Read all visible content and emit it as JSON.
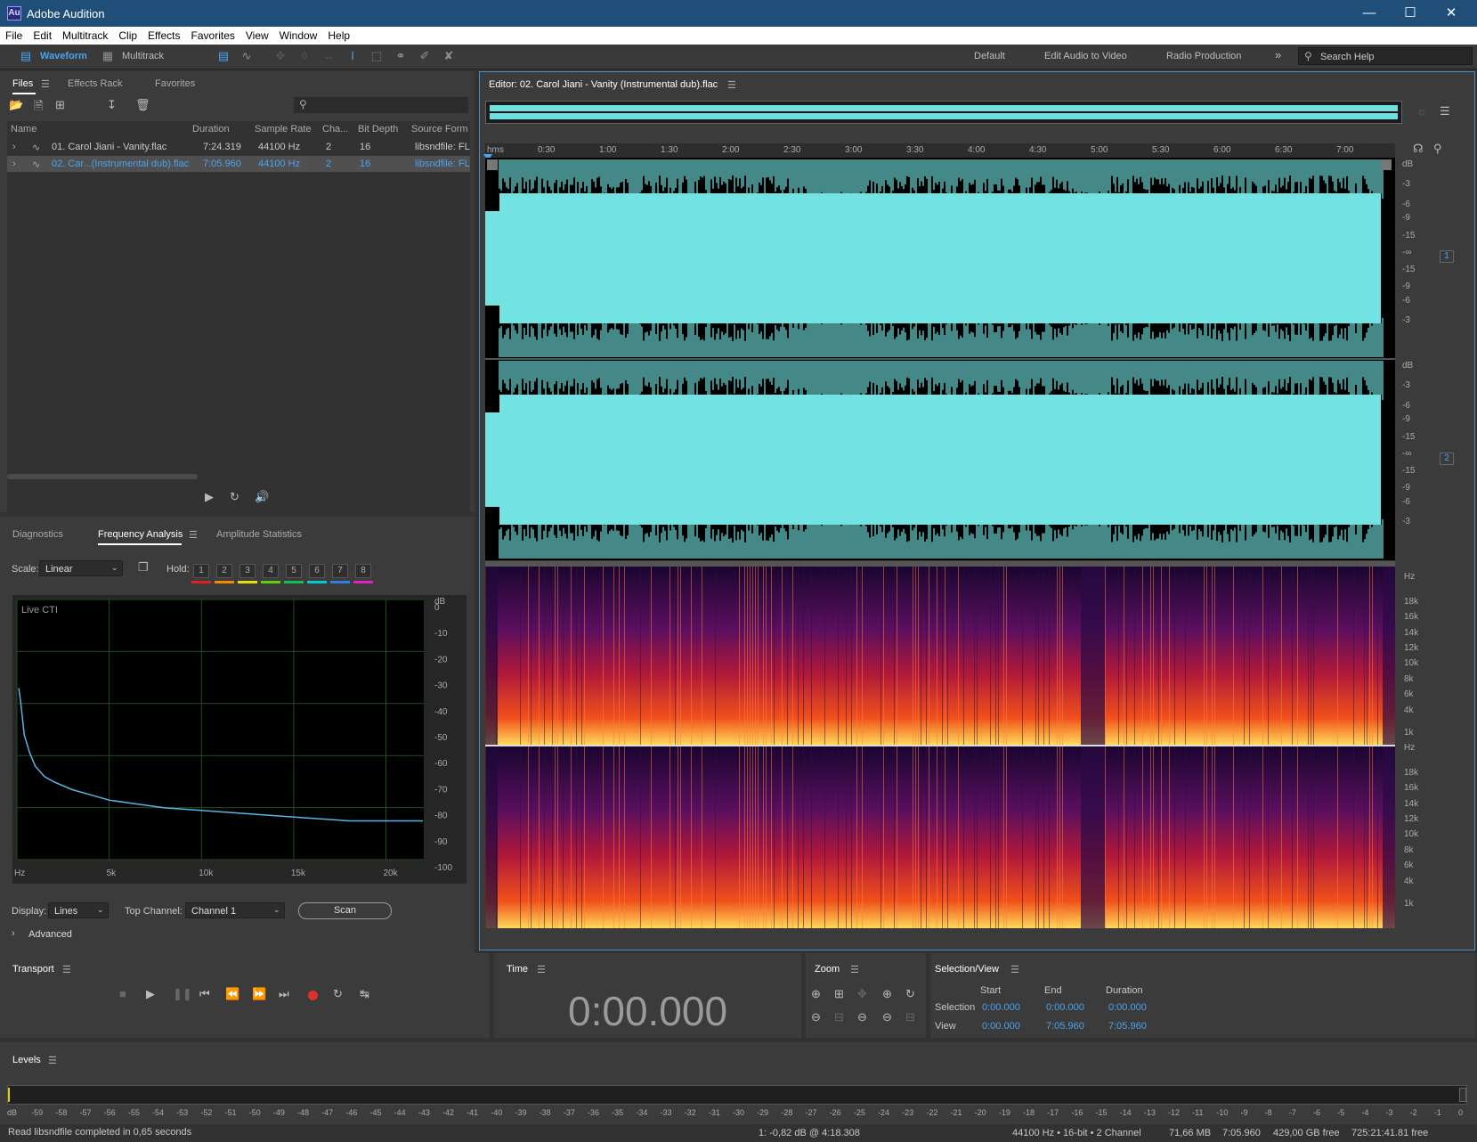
{
  "app": {
    "title": "Adobe Audition",
    "logo": "Au",
    "window_controls": [
      "minimize-icon",
      "maximize-icon",
      "close-icon"
    ]
  },
  "menu": [
    "File",
    "Edit",
    "Multitrack",
    "Clip",
    "Effects",
    "Favorites",
    "View",
    "Window",
    "Help"
  ],
  "toolbar": {
    "waveform": "Waveform",
    "multitrack": "Multitrack",
    "workspaces": [
      "Default",
      "Edit Audio to Video",
      "Radio Production"
    ],
    "more": "»",
    "search": "Search Help"
  },
  "files": {
    "tabs": [
      "Files",
      "Effects Rack",
      "Favorites"
    ],
    "columns": [
      "Name",
      "Duration",
      "Sample Rate",
      "Cha...",
      "Bit Depth",
      "Source Form"
    ],
    "rows": [
      {
        "name": "01. Carol Jiani - Vanity.flac",
        "duration": "7:24.319",
        "rate": "44100 Hz",
        "channels": "2",
        "depth": "16",
        "source": "libsndfile: FL"
      },
      {
        "name": "02. Car...(Instrumental dub).flac",
        "duration": "7:05.960",
        "rate": "44100 Hz",
        "channels": "2",
        "depth": "16",
        "source": "libsndfile: FL"
      }
    ]
  },
  "analysis": {
    "tabs": [
      "Diagnostics",
      "Frequency Analysis",
      "Amplitude Statistics"
    ],
    "scale_label": "Scale:",
    "scale_value": "Linear",
    "hold_label": "Hold:",
    "hold": [
      "1",
      "2",
      "3",
      "4",
      "5",
      "6",
      "7",
      "8"
    ],
    "hold_colors": [
      "#e02020",
      "#f08a00",
      "#e8e000",
      "#5cd000",
      "#10c050",
      "#00c8d8",
      "#2f7fe0",
      "#e020c0"
    ],
    "graph_label": "Live CTI",
    "display_label": "Display:",
    "display_value": "Lines",
    "top_channel_label": "Top Channel:",
    "top_channel_value": "Channel 1",
    "scan": "Scan",
    "advanced": "Advanced"
  },
  "chart_data": {
    "type": "line",
    "title": "Live CTI",
    "xlabel": "Hz",
    "ylabel": "dB",
    "xlim": [
      0,
      22050
    ],
    "ylim": [
      -100,
      0
    ],
    "grid": true,
    "x_ticks": [
      "Hz",
      "5k",
      "10k",
      "15k",
      "20k"
    ],
    "y_ticks": [
      "dB",
      "0",
      "-10",
      "-20",
      "-30",
      "-40",
      "-50",
      "-60",
      "-70",
      "-80",
      "-90",
      "-100"
    ],
    "series": [
      {
        "x": [
          100,
          200,
          400,
          700,
          1000,
          1500,
          2000,
          3000,
          4000,
          5000,
          6000,
          7000,
          8000,
          10000,
          12000,
          14000,
          16000,
          18000,
          20000,
          22000
        ],
        "y": [
          -30,
          -35,
          -48,
          -55,
          -60,
          -64,
          -66,
          -69,
          -71,
          -73,
          -74,
          -75,
          -76,
          -77,
          -78,
          -79,
          -80,
          -81,
          -81,
          -81
        ]
      }
    ]
  },
  "editor": {
    "title": "Editor: 02. Carol Jiani - Vanity (Instrumental dub).flac",
    "time_ruler": [
      "hms",
      "0:30",
      "1:00",
      "1:30",
      "2:00",
      "2:30",
      "3:00",
      "3:30",
      "4:00",
      "4:30",
      "5:00",
      "5:30",
      "6:00",
      "6:30",
      "7:00"
    ],
    "db_scale": [
      "dB",
      "-3",
      "-6",
      "-9",
      "-15",
      "-∞",
      "-15",
      "-9",
      "-6",
      "-3"
    ],
    "channel1": "1",
    "channel2": "2",
    "hz_scale": [
      "Hz",
      "18k",
      "16k",
      "14k",
      "12k",
      "10k",
      "8k",
      "6k",
      "4k",
      "1k"
    ]
  },
  "transport": {
    "title": "Transport"
  },
  "time": {
    "title": "Time",
    "value": "0:00.000"
  },
  "zoom": {
    "title": "Zoom"
  },
  "selection": {
    "title": "Selection/View",
    "headers": [
      "Start",
      "End",
      "Duration"
    ],
    "selection_label": "Selection",
    "view_label": "View",
    "selection": [
      "0:00.000",
      "0:00.000",
      "0:00.000"
    ],
    "view": [
      "0:00.000",
      "7:05.960",
      "7:05.960"
    ]
  },
  "levels": {
    "title": "Levels",
    "scale": [
      "dB",
      "-59",
      "-58",
      "-57",
      "-56",
      "-55",
      "-54",
      "-53",
      "-52",
      "-51",
      "-50",
      "-49",
      "-48",
      "-47",
      "-46",
      "-45",
      "-44",
      "-43",
      "-42",
      "-41",
      "-40",
      "-39",
      "-38",
      "-37",
      "-36",
      "-35",
      "-34",
      "-33",
      "-32",
      "-31",
      "-30",
      "-29",
      "-28",
      "-27",
      "-26",
      "-25",
      "-24",
      "-23",
      "-22",
      "-21",
      "-20",
      "-19",
      "-18",
      "-17",
      "-16",
      "-15",
      "-14",
      "-13",
      "-12",
      "-11",
      "-10",
      "-9",
      "-8",
      "-7",
      "-6",
      "-5",
      "-4",
      "-3",
      "-2",
      "-1",
      "0"
    ]
  },
  "status": {
    "message": "Read libsndfile completed in 0,65 seconds",
    "cursor": "1: -0,82 dB @ 4:18.308",
    "format": "44100 Hz • 16-bit • 2 Channel",
    "size": "71,66 MB",
    "duration": "7:05.960",
    "free": "429,00 GB free",
    "time_free": "725:21:41.81 free"
  }
}
